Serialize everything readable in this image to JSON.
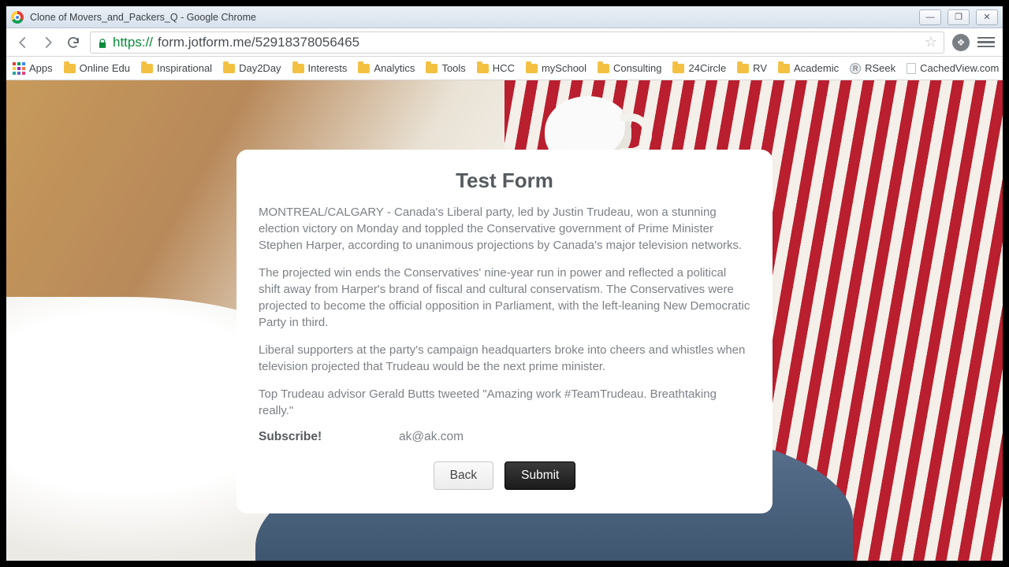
{
  "window": {
    "title": "Clone of Movers_and_Packers_Q - Google Chrome"
  },
  "addressbar": {
    "scheme": "https://",
    "host_and_path": "form.jotform.me/52918378056465"
  },
  "bookmarks": {
    "apps_label": "Apps",
    "items": [
      "Online Edu",
      "Inspirational",
      "Day2Day",
      "Interests",
      "Analytics",
      "Tools",
      "HCC",
      "mySchool",
      "Consulting",
      "24Circle",
      "RV",
      "Academic"
    ],
    "rseek_label": "RSeek",
    "cached_label": "CachedView.com",
    "overflow_glyph": "»"
  },
  "form": {
    "title": "Test Form",
    "p1": "MONTREAL/CALGARY - Canada's Liberal party, led by Justin Trudeau, won a stunning election victory on Monday and toppled the Conservative government of Prime Minister Stephen Harper, according to unanimous projections by Canada's major television networks.",
    "p2": "The projected win ends the Conservatives' nine-year run in power and reflected a political shift away from Harper's brand of fiscal and cultural conservatism. The Conservatives were projected to become the official opposition in Parliament, with the left-leaning New Democratic Party in third.",
    "p3": "Liberal supporters at the party's campaign headquarters broke into cheers and whistles when television projected that Trudeau would be the next prime minister.",
    "p4": "Top Trudeau advisor Gerald Butts tweeted \"Amazing work #TeamTrudeau. Breathtaking really.\"",
    "subscribe_label": "Subscribe!",
    "subscribe_value": "ak@ak.com",
    "back_label": "Back",
    "submit_label": "Submit"
  }
}
